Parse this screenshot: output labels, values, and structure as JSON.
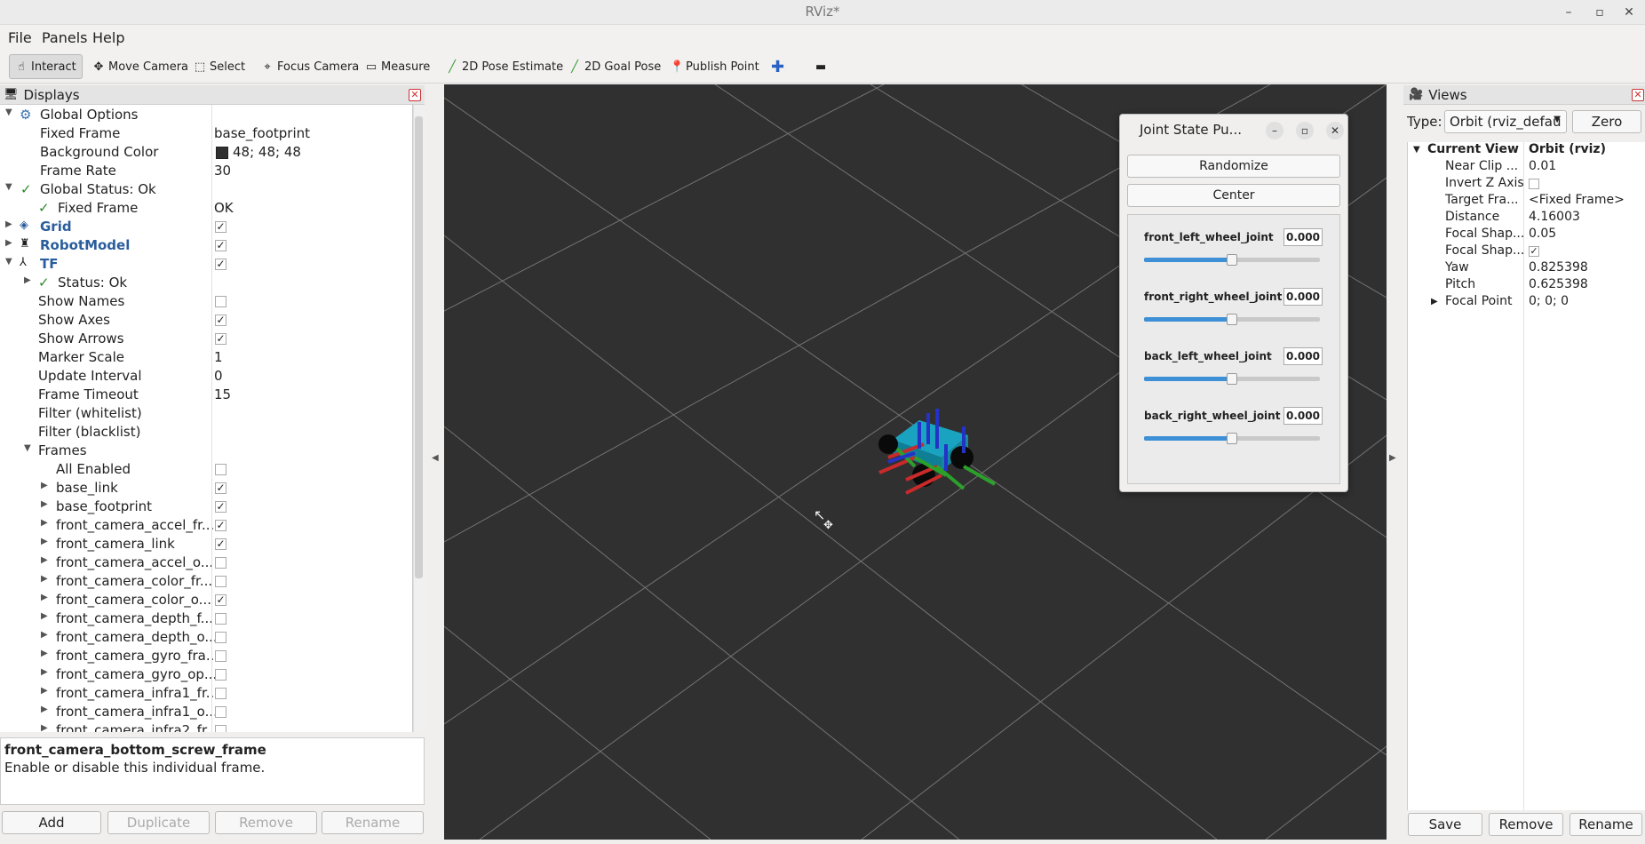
{
  "window": {
    "title": "RViz*"
  },
  "menu": [
    "File",
    "Panels",
    "Help"
  ],
  "toolbar": {
    "interact": "Interact",
    "move_camera": "Move Camera",
    "select": "Select",
    "focus_camera": "Focus Camera",
    "measure": "Measure",
    "pose_estimate": "2D Pose Estimate",
    "goal_pose": "2D Goal Pose",
    "publish_point": "Publish Point"
  },
  "displays": {
    "title": "Displays",
    "rows": [
      {
        "label": "Global Options",
        "value": ""
      },
      {
        "label": "Fixed Frame",
        "value": "base_footprint"
      },
      {
        "label": "Background Color",
        "value": "48; 48; 48"
      },
      {
        "label": "Frame Rate",
        "value": "30"
      },
      {
        "label": "Global Status: Ok",
        "value": ""
      },
      {
        "label": "Fixed Frame",
        "value": "OK"
      },
      {
        "label": "Grid",
        "value": ""
      },
      {
        "label": "RobotModel",
        "value": ""
      },
      {
        "label": "TF",
        "value": ""
      },
      {
        "label": "Status: Ok",
        "value": ""
      },
      {
        "label": "Show Names",
        "value": ""
      },
      {
        "label": "Show Axes",
        "value": ""
      },
      {
        "label": "Show Arrows",
        "value": ""
      },
      {
        "label": "Marker Scale",
        "value": "1"
      },
      {
        "label": "Update Interval",
        "value": "0"
      },
      {
        "label": "Frame Timeout",
        "value": "15"
      },
      {
        "label": "Filter (whitelist)",
        "value": ""
      },
      {
        "label": "Filter (blacklist)",
        "value": ""
      },
      {
        "label": "Frames",
        "value": ""
      },
      {
        "label": "All Enabled",
        "value": ""
      },
      {
        "label": "base_link",
        "value": ""
      },
      {
        "label": "base_footprint",
        "value": ""
      },
      {
        "label": "front_camera_accel_fr...",
        "value": ""
      },
      {
        "label": "front_camera_link",
        "value": ""
      },
      {
        "label": "front_camera_accel_o...",
        "value": ""
      },
      {
        "label": "front_camera_color_fr...",
        "value": ""
      },
      {
        "label": "front_camera_color_o...",
        "value": ""
      },
      {
        "label": "front_camera_depth_f...",
        "value": ""
      },
      {
        "label": "front_camera_depth_o...",
        "value": ""
      },
      {
        "label": "front_camera_gyro_fra...",
        "value": ""
      },
      {
        "label": "front_camera_gyro_op...",
        "value": ""
      },
      {
        "label": "front_camera_infra1_fr...",
        "value": ""
      },
      {
        "label": "front_camera_infra1_o...",
        "value": ""
      },
      {
        "label": "front_camera_infra2_fr...",
        "value": ""
      }
    ],
    "description_title": "front_camera_bottom_screw_frame",
    "description_text": "Enable or disable this individual frame.",
    "buttons": {
      "add": "Add",
      "duplicate": "Duplicate",
      "remove": "Remove",
      "rename": "Rename"
    }
  },
  "joint_publisher": {
    "title": "Joint State Pu...",
    "randomize": "Randomize",
    "center": "Center",
    "joints": [
      {
        "name": "front_left_wheel_joint",
        "value": "0.000",
        "position": 0.5
      },
      {
        "name": "front_right_wheel_joint",
        "value": "0.000",
        "position": 0.5
      },
      {
        "name": "back_left_wheel_joint",
        "value": "0.000",
        "position": 0.5
      },
      {
        "name": "back_right_wheel_joint",
        "value": "0.000",
        "position": 0.5
      }
    ]
  },
  "views": {
    "title": "Views",
    "type_label": "Type:",
    "type_value": "Orbit (rviz_defau",
    "zero": "Zero",
    "current_view": "Current View",
    "current_view_value": "Orbit (rviz)",
    "props": [
      {
        "label": "Near Clip ...",
        "value": "0.01"
      },
      {
        "label": "Invert Z Axis",
        "value": ""
      },
      {
        "label": "Target Fra...",
        "value": "<Fixed Frame>"
      },
      {
        "label": "Distance",
        "value": "4.16003"
      },
      {
        "label": "Focal Shap...",
        "value": "0.05"
      },
      {
        "label": "Focal Shap...",
        "value": ""
      },
      {
        "label": "Yaw",
        "value": "0.825398"
      },
      {
        "label": "Pitch",
        "value": "0.625398"
      },
      {
        "label": "Focal Point",
        "value": "0; 0; 0"
      }
    ],
    "buttons": {
      "save": "Save",
      "remove": "Remove",
      "rename": "Rename"
    }
  },
  "colors": {
    "background": "#303030",
    "slider_fill": "#3d8fd6",
    "link_blue": "#2a5d9c"
  }
}
